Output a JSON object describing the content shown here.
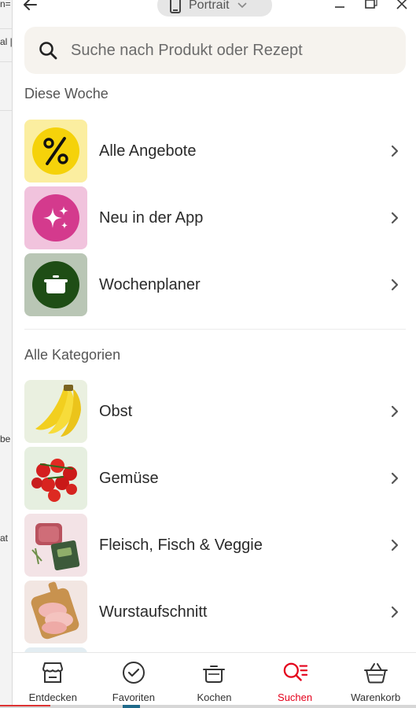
{
  "host": {
    "fragments": [
      "n=",
      "al |",
      "be",
      "at"
    ]
  },
  "topbar": {
    "device_label": "Portrait"
  },
  "search": {
    "placeholder": "Suche nach Produkt oder Rezept"
  },
  "sections": {
    "this_week": "Diese Woche",
    "all_categories": "Alle Kategorien"
  },
  "this_week_items": [
    {
      "label": "Alle Angebote",
      "icon": "percent-icon",
      "bg": "#fbeea0",
      "circle": "#f5d20a"
    },
    {
      "label": "Neu in der App",
      "icon": "sparkles-icon",
      "bg": "#f1c3dd",
      "circle": "#d43a8d"
    },
    {
      "label": "Wochenplaner",
      "icon": "pot-icon",
      "bg": "#b9c6b5",
      "circle": "#1e4d15"
    }
  ],
  "categories": [
    {
      "label": "Obst",
      "image": "banana-image"
    },
    {
      "label": "Gemüse",
      "image": "tomato-image"
    },
    {
      "label": "Fleisch, Fisch & Veggie",
      "image": "meat-image"
    },
    {
      "label": "Wurstaufschnitt",
      "image": "cold-cuts-image"
    }
  ],
  "bottom_nav": [
    {
      "label": "Entdecken",
      "icon": "store-icon",
      "active": false
    },
    {
      "label": "Favoriten",
      "icon": "check-circle-icon",
      "active": false
    },
    {
      "label": "Kochen",
      "icon": "pot-icon",
      "active": false
    },
    {
      "label": "Suchen",
      "icon": "search-list-icon",
      "active": true
    },
    {
      "label": "Warenkorb",
      "icon": "basket-icon",
      "active": false
    }
  ],
  "colors": {
    "accent": "#e4001b",
    "search_bg": "#f6f3ee"
  }
}
